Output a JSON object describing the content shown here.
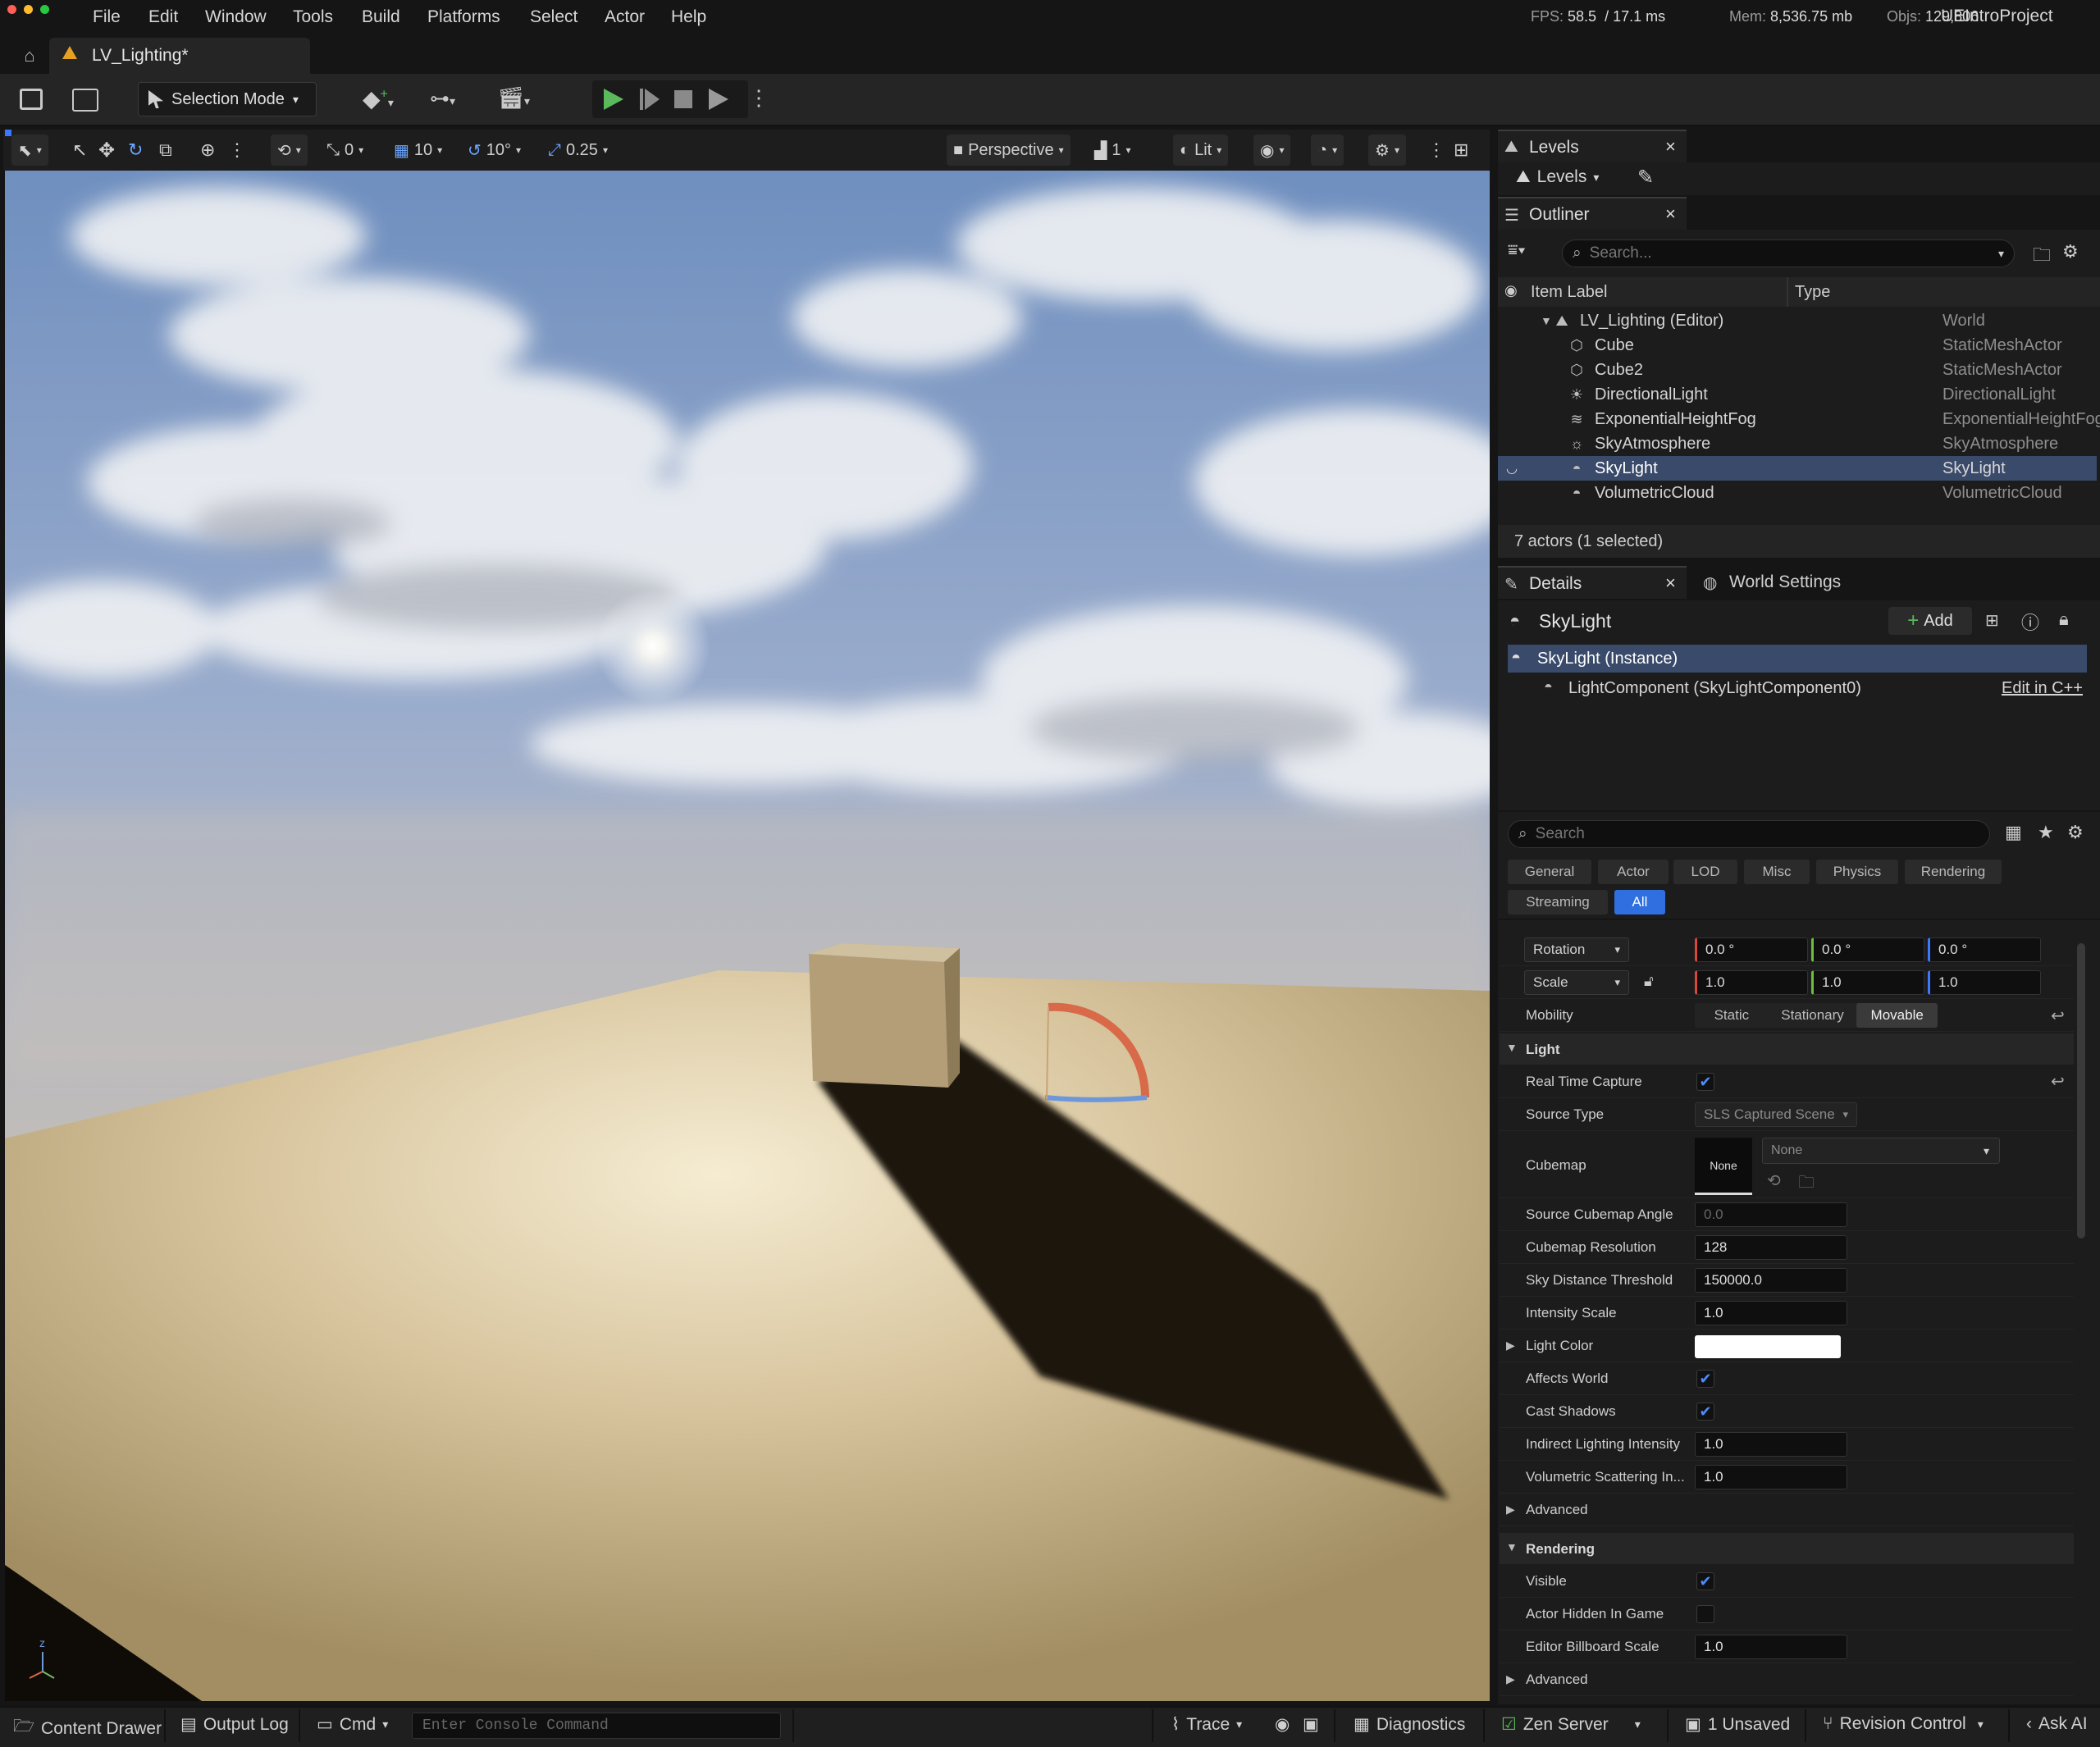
{
  "menubar": {
    "items": [
      "File",
      "Edit",
      "Window",
      "Tools",
      "Build",
      "Platforms",
      "Select",
      "Actor",
      "Help"
    ],
    "fps_label": "FPS:",
    "fps": "58.5",
    "frame_ms": "/ 17.1 ms",
    "mem_label": "Mem:",
    "mem": "8,536.75 mb",
    "objs_label": "Objs:",
    "objs": "129,806",
    "project": "UEIntroProject"
  },
  "tab": {
    "title": "LV_Lighting*"
  },
  "toolbar": {
    "selection_mode": "Selection Mode"
  },
  "viewport_toolbar": {
    "rotation_snap": "0",
    "grid_snap": "10",
    "angle_snap": "10°",
    "scale_snap": "0.25",
    "perspective": "Perspective",
    "layout_count": "1",
    "view_mode": "Lit"
  },
  "levels_panel": {
    "tab": "Levels",
    "dropdown": "Levels"
  },
  "outliner": {
    "tab": "Outliner",
    "search_placeholder": "Search...",
    "col_label": "Item Label",
    "col_type": "Type",
    "root": {
      "label": "LV_Lighting (Editor)",
      "type": "World"
    },
    "items": [
      {
        "label": "Cube",
        "type": "StaticMeshActor",
        "icon": "static-mesh-icon"
      },
      {
        "label": "Cube2",
        "type": "StaticMeshActor",
        "icon": "static-mesh-icon"
      },
      {
        "label": "DirectionalLight",
        "type": "DirectionalLight",
        "icon": "directional-light-icon"
      },
      {
        "label": "ExponentialHeightFog",
        "type": "ExponentialHeightFog",
        "icon": "fog-icon"
      },
      {
        "label": "SkyAtmosphere",
        "type": "SkyAtmosphere",
        "icon": "sky-atmosphere-icon"
      },
      {
        "label": "SkyLight",
        "type": "SkyLight",
        "icon": "skylight-icon"
      },
      {
        "label": "VolumetricCloud",
        "type": "VolumetricCloud",
        "icon": "cloud-icon"
      }
    ],
    "footer": "7 actors (1 selected)"
  },
  "details": {
    "tab": "Details",
    "world_settings_tab": "World Settings",
    "actor_name": "SkyLight",
    "add_label": "Add",
    "instance": "SkyLight (Instance)",
    "component": "LightComponent (SkyLightComponent0)",
    "edit_cpp": "Edit in C++",
    "search_placeholder": "Search",
    "categories": [
      "General",
      "Actor",
      "LOD",
      "Misc",
      "Physics",
      "Rendering",
      "Streaming",
      "All"
    ],
    "transform": {
      "rotation_label": "Rotation",
      "rotation": [
        "0.0 °",
        "0.0 °",
        "0.0 °"
      ],
      "scale_label": "Scale",
      "scale": [
        "1.0",
        "1.0",
        "1.0"
      ],
      "mobility_label": "Mobility",
      "mobility": [
        "Static",
        "Stationary",
        "Movable"
      ]
    },
    "light_section": "Light",
    "props": {
      "real_time_capture": "Real Time Capture",
      "source_type": "Source Type",
      "source_type_value": "SLS Captured Scene",
      "cubemap": "Cubemap",
      "cubemap_thumb": "None",
      "cubemap_dropdown": "None",
      "source_cubemap_angle": "Source Cubemap Angle",
      "source_cubemap_angle_value": "0.0",
      "cubemap_resolution": "Cubemap Resolution",
      "cubemap_resolution_value": "128",
      "sky_distance_threshold": "Sky Distance Threshold",
      "sky_distance_threshold_value": "150000.0",
      "intensity_scale": "Intensity Scale",
      "intensity_scale_value": "1.0",
      "light_color": "Light Color",
      "affects_world": "Affects World",
      "cast_shadows": "Cast Shadows",
      "indirect_lighting_intensity": "Indirect Lighting Intensity",
      "indirect_lighting_intensity_value": "1.0",
      "volumetric_scattering": "Volumetric Scattering In...",
      "volumetric_scattering_value": "1.0",
      "advanced": "Advanced"
    },
    "rendering_section": "Rendering",
    "rendering": {
      "visible": "Visible",
      "actor_hidden": "Actor Hidden In Game",
      "billboard_scale": "Editor Billboard Scale",
      "billboard_scale_value": "1.0",
      "advanced": "Advanced"
    }
  },
  "statusbar": {
    "content_drawer": "Content Drawer",
    "output_log": "Output Log",
    "cmd": "Cmd",
    "console_placeholder": "Enter Console Command",
    "trace": "Trace",
    "diagnostics": "Diagnostics",
    "zen_server": "Zen Server",
    "unsaved": "1 Unsaved",
    "revision_control": "Revision Control",
    "ask_ai": "Ask AI"
  },
  "colors": {
    "accent": "#4f8cff",
    "selected_row": "#3a4a6a",
    "all_tab": "#2f6fe0",
    "play_green": "#5cb85c"
  }
}
